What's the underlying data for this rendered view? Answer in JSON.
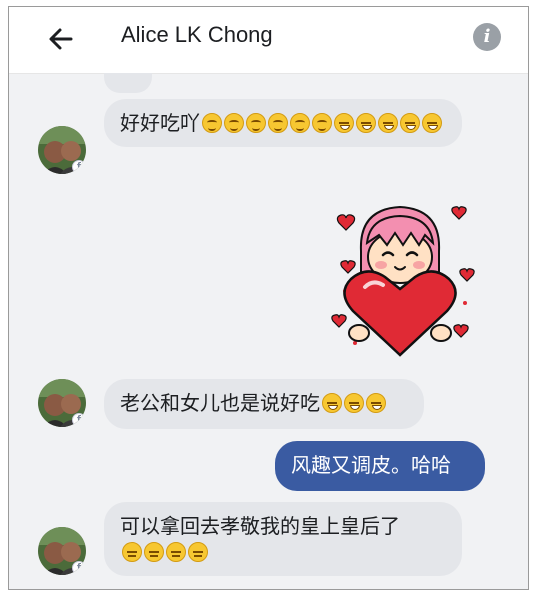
{
  "header": {
    "contact_name": "Alice LK Chong",
    "back_icon": "arrow-left-icon",
    "info_icon": "info-icon",
    "info_glyph": "i"
  },
  "avatar": {
    "badge_glyph": "f"
  },
  "messages": [
    {
      "from": "them",
      "text": "好好吃吖",
      "emojis": [
        "smile",
        "smile",
        "smile",
        "smile",
        "smile",
        "smile",
        "laugh",
        "laugh",
        "laugh",
        "laugh",
        "laugh"
      ]
    },
    {
      "from": "me",
      "type": "sticker",
      "sticker": "girl-holding-heart"
    },
    {
      "from": "them",
      "text": "老公和女儿也是说好吃",
      "emojis": [
        "laugh",
        "laugh",
        "laugh"
      ]
    },
    {
      "from": "me",
      "text": "风趣又调皮。哈哈"
    },
    {
      "from": "them",
      "text": "可以拿回去孝敬我的皇上皇后了",
      "emojis": [
        "expressionless",
        "expressionless",
        "expressionless",
        "expressionless"
      ]
    }
  ],
  "colors": {
    "outgoing_bubble": "#3a5ba2",
    "incoming_bubble": "#e4e6ea",
    "background": "#f1f2f4"
  }
}
